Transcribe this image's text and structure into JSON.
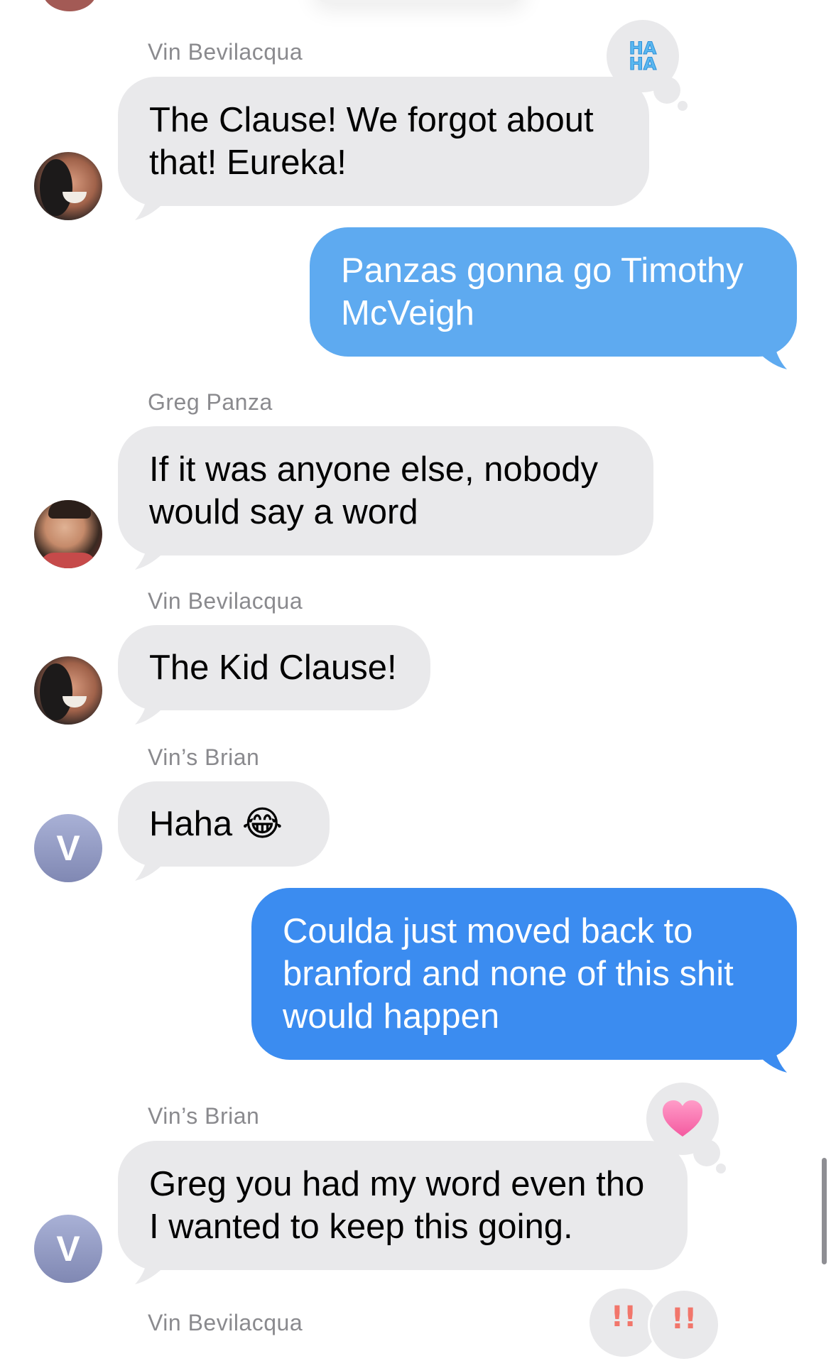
{
  "messages": [
    {
      "sender": "Vin Bevilacqua",
      "text": "The Clause! We forgot about that! Eureka!",
      "reaction": "HA HA"
    },
    {
      "text": "Panzas gonna go Timothy McVeigh"
    },
    {
      "sender": "Greg Panza",
      "text": "If it was anyone else, nobody would say a word"
    },
    {
      "sender": "Vin Bevilacqua",
      "text": "The Kid Clause!"
    },
    {
      "sender": "Vin’s Brian",
      "text": "Haha 😂",
      "avatar_initial": "V"
    },
    {
      "text": "Coulda just moved back to branford and none of this shit would happen"
    },
    {
      "sender": "Vin’s Brian",
      "text": "Greg you had my word even tho I wanted to keep this going.",
      "avatar_initial": "V",
      "reaction": "heart"
    },
    {
      "sender": "Vin Bevilacqua"
    }
  ],
  "colors": {
    "received_bubble": "#e9e9eb",
    "sent_bubble_light": "#5eaaf0",
    "sent_bubble": "#3b8cf0",
    "reaction_bubble": "#e9e9eb"
  }
}
